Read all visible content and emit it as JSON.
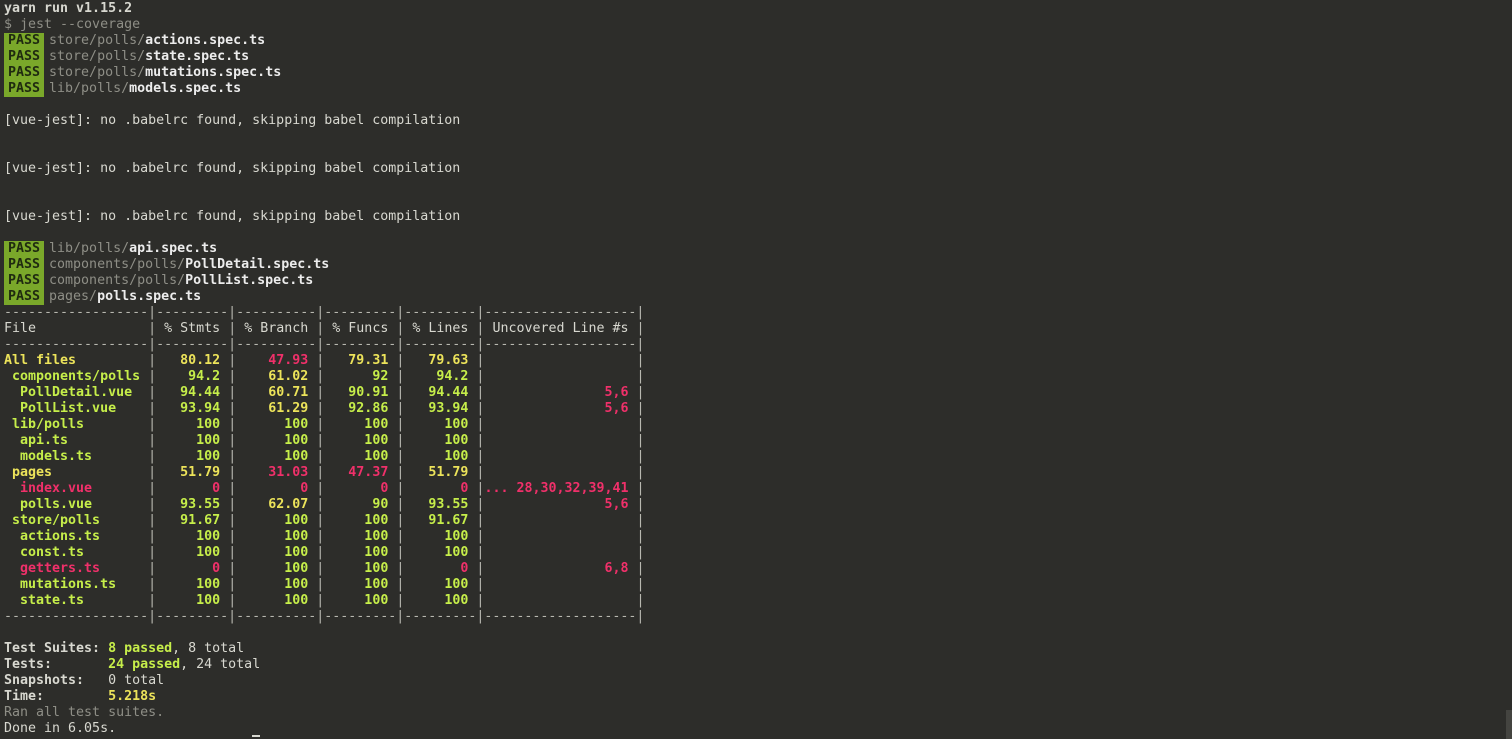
{
  "header": {
    "yarn": "yarn run v1.15.2",
    "command": "$ jest --coverage"
  },
  "pass_label": "PASS",
  "passes_a": [
    {
      "dir": "store/polls/",
      "file": "actions.spec.ts"
    },
    {
      "dir": "store/polls/",
      "file": "state.spec.ts"
    },
    {
      "dir": "store/polls/",
      "file": "mutations.spec.ts"
    },
    {
      "dir": "lib/polls/",
      "file": "models.spec.ts"
    }
  ],
  "vue_jest_warning": "[vue-jest]: no .babelrc found, skipping babel compilation",
  "passes_b": [
    {
      "dir": "lib/polls/",
      "file": "api.spec.ts"
    },
    {
      "dir": "components/polls/",
      "file": "PollDetail.spec.ts"
    },
    {
      "dir": "components/polls/",
      "file": "PollList.spec.ts"
    },
    {
      "dir": "pages/",
      "file": "polls.spec.ts"
    }
  ],
  "coverage": {
    "headers": [
      "File",
      "% Stmts",
      "% Branch",
      "% Funcs",
      "% Lines",
      "Uncovered Line #s"
    ],
    "rows": [
      {
        "name": "All files",
        "indent": 0,
        "stmts": "80.12",
        "branch": "47.93",
        "funcs": "79.31",
        "lines": "79.63",
        "uncovered": "",
        "colors": [
          "y",
          "y",
          "r",
          "y",
          "y",
          "r"
        ]
      },
      {
        "name": "components/polls",
        "indent": 1,
        "stmts": "94.2",
        "branch": "61.02",
        "funcs": "92",
        "lines": "94.2",
        "uncovered": "",
        "colors": [
          "g",
          "g",
          "y",
          "g",
          "g",
          "r"
        ]
      },
      {
        "name": "PollDetail.vue",
        "indent": 2,
        "stmts": "94.44",
        "branch": "60.71",
        "funcs": "90.91",
        "lines": "94.44",
        "uncovered": "5,6",
        "colors": [
          "g",
          "g",
          "y",
          "g",
          "g",
          "r"
        ]
      },
      {
        "name": "PollList.vue",
        "indent": 2,
        "stmts": "93.94",
        "branch": "61.29",
        "funcs": "92.86",
        "lines": "93.94",
        "uncovered": "5,6",
        "colors": [
          "g",
          "g",
          "y",
          "g",
          "g",
          "r"
        ]
      },
      {
        "name": "lib/polls",
        "indent": 1,
        "stmts": "100",
        "branch": "100",
        "funcs": "100",
        "lines": "100",
        "uncovered": "",
        "colors": [
          "g",
          "g",
          "g",
          "g",
          "g",
          "r"
        ]
      },
      {
        "name": "api.ts",
        "indent": 2,
        "stmts": "100",
        "branch": "100",
        "funcs": "100",
        "lines": "100",
        "uncovered": "",
        "colors": [
          "g",
          "g",
          "g",
          "g",
          "g",
          "r"
        ]
      },
      {
        "name": "models.ts",
        "indent": 2,
        "stmts": "100",
        "branch": "100",
        "funcs": "100",
        "lines": "100",
        "uncovered": "",
        "colors": [
          "g",
          "g",
          "g",
          "g",
          "g",
          "r"
        ]
      },
      {
        "name": "pages",
        "indent": 1,
        "stmts": "51.79",
        "branch": "31.03",
        "funcs": "47.37",
        "lines": "51.79",
        "uncovered": "",
        "colors": [
          "y",
          "y",
          "r",
          "r",
          "y",
          "r"
        ]
      },
      {
        "name": "index.vue",
        "indent": 2,
        "stmts": "0",
        "branch": "0",
        "funcs": "0",
        "lines": "0",
        "uncovered": "... 28,30,32,39,41",
        "colors": [
          "r",
          "r",
          "r",
          "r",
          "r",
          "r"
        ]
      },
      {
        "name": "polls.vue",
        "indent": 2,
        "stmts": "93.55",
        "branch": "62.07",
        "funcs": "90",
        "lines": "93.55",
        "uncovered": "5,6",
        "colors": [
          "g",
          "g",
          "y",
          "g",
          "g",
          "r"
        ]
      },
      {
        "name": "store/polls",
        "indent": 1,
        "stmts": "91.67",
        "branch": "100",
        "funcs": "100",
        "lines": "91.67",
        "uncovered": "",
        "colors": [
          "g",
          "g",
          "g",
          "g",
          "g",
          "r"
        ]
      },
      {
        "name": "actions.ts",
        "indent": 2,
        "stmts": "100",
        "branch": "100",
        "funcs": "100",
        "lines": "100",
        "uncovered": "",
        "colors": [
          "g",
          "g",
          "g",
          "g",
          "g",
          "r"
        ]
      },
      {
        "name": "const.ts",
        "indent": 2,
        "stmts": "100",
        "branch": "100",
        "funcs": "100",
        "lines": "100",
        "uncovered": "",
        "colors": [
          "g",
          "g",
          "g",
          "g",
          "g",
          "r"
        ]
      },
      {
        "name": "getters.ts",
        "indent": 2,
        "stmts": "0",
        "branch": "100",
        "funcs": "100",
        "lines": "0",
        "uncovered": "6,8",
        "colors": [
          "r",
          "r",
          "g",
          "g",
          "r",
          "r"
        ]
      },
      {
        "name": "mutations.ts",
        "indent": 2,
        "stmts": "100",
        "branch": "100",
        "funcs": "100",
        "lines": "100",
        "uncovered": "",
        "colors": [
          "g",
          "g",
          "g",
          "g",
          "g",
          "r"
        ]
      },
      {
        "name": "state.ts",
        "indent": 2,
        "stmts": "100",
        "branch": "100",
        "funcs": "100",
        "lines": "100",
        "uncovered": "",
        "colors": [
          "g",
          "g",
          "g",
          "g",
          "g",
          "r"
        ]
      }
    ]
  },
  "summary": {
    "suites_label": "Test Suites: ",
    "suites_passed": "8 passed",
    "suites_total": ", 8 total",
    "tests_label": "Tests:       ",
    "tests_passed": "24 passed",
    "tests_total": ", 24 total",
    "snapshots_label": "Snapshots:   ",
    "snapshots_value": "0 total",
    "time_label": "Time:        ",
    "time_value": "5.218s",
    "ran_all": "Ran all test suites.",
    "done": "Done in 6.05s."
  },
  "colors": {
    "background": "#2d2d2a",
    "pass_badge": "#7aa82a",
    "green": "#c6ee4a",
    "yellow": "#ece35a",
    "red": "#f0306a"
  }
}
